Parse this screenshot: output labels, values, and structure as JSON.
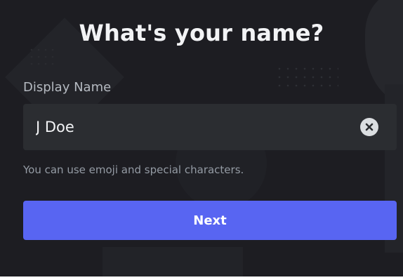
{
  "heading": "What's your name?",
  "display_name": {
    "label": "Display Name",
    "value": "J Doe",
    "clear_icon": "clear-icon",
    "hint": "You can use emoji and special characters."
  },
  "next_button": {
    "label": "Next"
  },
  "colors": {
    "background": "#1d1d22",
    "input_background": "#2b2d31",
    "primary_button": "#5865f2",
    "text_primary": "#f2f3f5",
    "text_muted": "#949ba4"
  }
}
